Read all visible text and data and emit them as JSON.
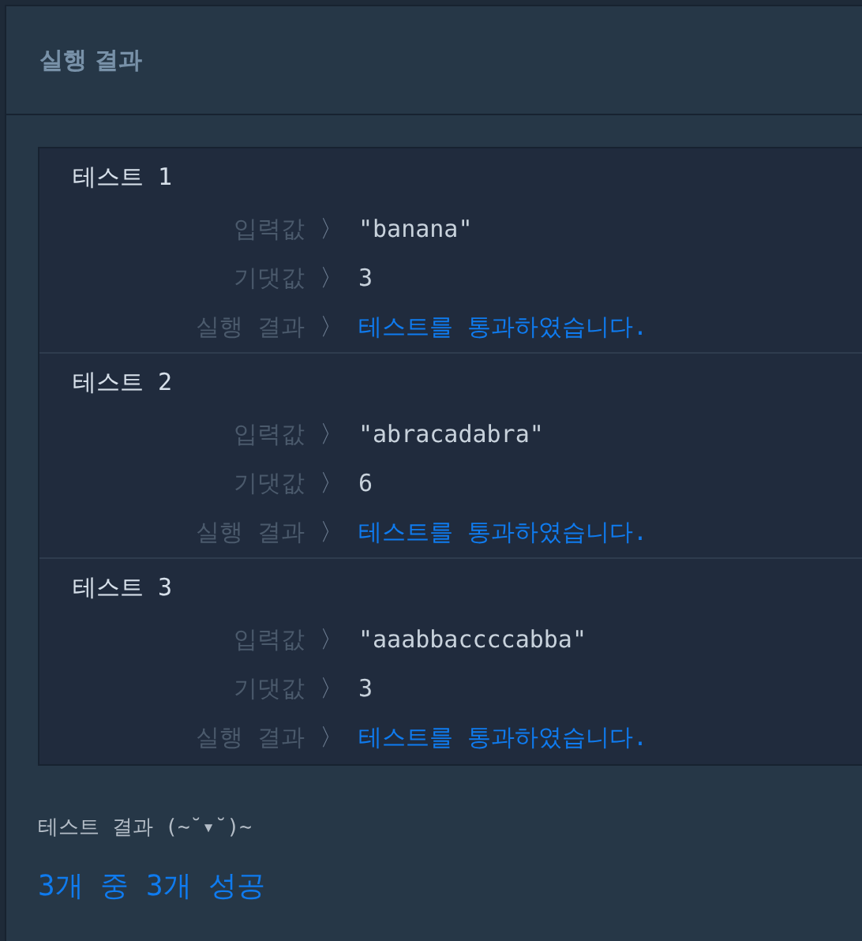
{
  "panel": {
    "title": "실행 결과"
  },
  "tests": [
    {
      "title": "테스트 1",
      "rows": [
        {
          "label": "입력값",
          "separator": "〉",
          "value": "\"banana\"",
          "kind": "plain"
        },
        {
          "label": "기댓값",
          "separator": "〉",
          "value": "3",
          "kind": "plain"
        },
        {
          "label": "실행 결과",
          "separator": "〉",
          "value": "테스트를 통과하였습니다.",
          "kind": "pass"
        }
      ]
    },
    {
      "title": "테스트 2",
      "rows": [
        {
          "label": "입력값",
          "separator": "〉",
          "value": "\"abracadabra\"",
          "kind": "plain"
        },
        {
          "label": "기댓값",
          "separator": "〉",
          "value": "6",
          "kind": "plain"
        },
        {
          "label": "실행 결과",
          "separator": "〉",
          "value": "테스트를 통과하였습니다.",
          "kind": "pass"
        }
      ]
    },
    {
      "title": "테스트 3",
      "rows": [
        {
          "label": "입력값",
          "separator": "〉",
          "value": "\"aaabbaccccabba\"",
          "kind": "plain"
        },
        {
          "label": "기댓값",
          "separator": "〉",
          "value": "3",
          "kind": "plain"
        },
        {
          "label": "실행 결과",
          "separator": "〉",
          "value": "테스트를 통과하였습니다.",
          "kind": "pass"
        }
      ]
    }
  ],
  "summary": {
    "heading": "테스트 결과 (~˘▾˘)~",
    "result": "3개 중 3개 성공"
  }
}
